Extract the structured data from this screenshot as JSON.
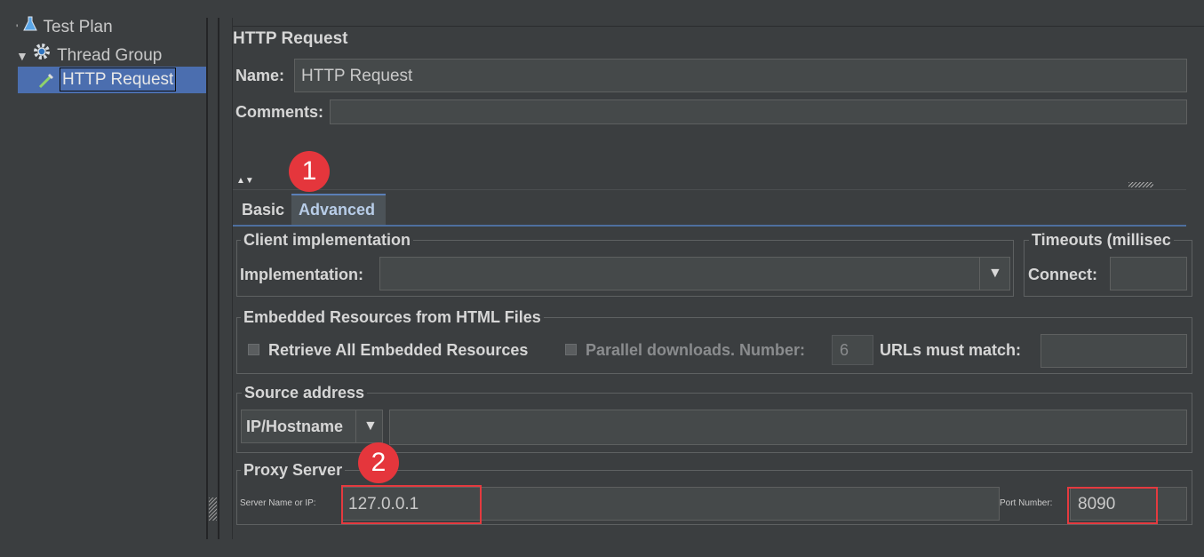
{
  "tree": {
    "items": [
      {
        "label": "Test Plan",
        "icon": "flask-icon"
      },
      {
        "label": "Thread Group",
        "icon": "gear-icon"
      },
      {
        "label": "HTTP Request",
        "icon": "pipette-icon"
      }
    ]
  },
  "panel": {
    "title": "HTTP Request",
    "name_label": "Name:",
    "name_value": "HTTP Request",
    "comments_label": "Comments:",
    "comments_value": ""
  },
  "tabs": {
    "basic": "Basic",
    "advanced": "Advanced"
  },
  "client": {
    "group_title": "Client implementation",
    "implementation_label": "Implementation:",
    "implementation_value": ""
  },
  "timeouts": {
    "group_title": "Timeouts (millisec",
    "connect_label": "Connect:",
    "connect_value": ""
  },
  "embedded": {
    "group_title": "Embedded Resources from HTML Files",
    "retrieve_label": "Retrieve All Embedded Resources",
    "parallel_label": "Parallel downloads. Number:",
    "parallel_value": "6",
    "urls_label": "URLs must match:",
    "urls_value": ""
  },
  "source": {
    "group_title": "Source address",
    "type_value": "IP/Hostname",
    "address_value": ""
  },
  "proxy": {
    "group_title": "Proxy Server",
    "server_label": "Server Name or IP:",
    "server_value": "127.0.0.1",
    "port_label": "Port Number:",
    "port_value": "8090"
  },
  "annotations": {
    "step1": "1",
    "step2": "2",
    "highlight_color": "#e43a3f"
  },
  "colors": {
    "background": "#3b3e40",
    "selection": "#4b6eaf",
    "field": "#45494a"
  }
}
